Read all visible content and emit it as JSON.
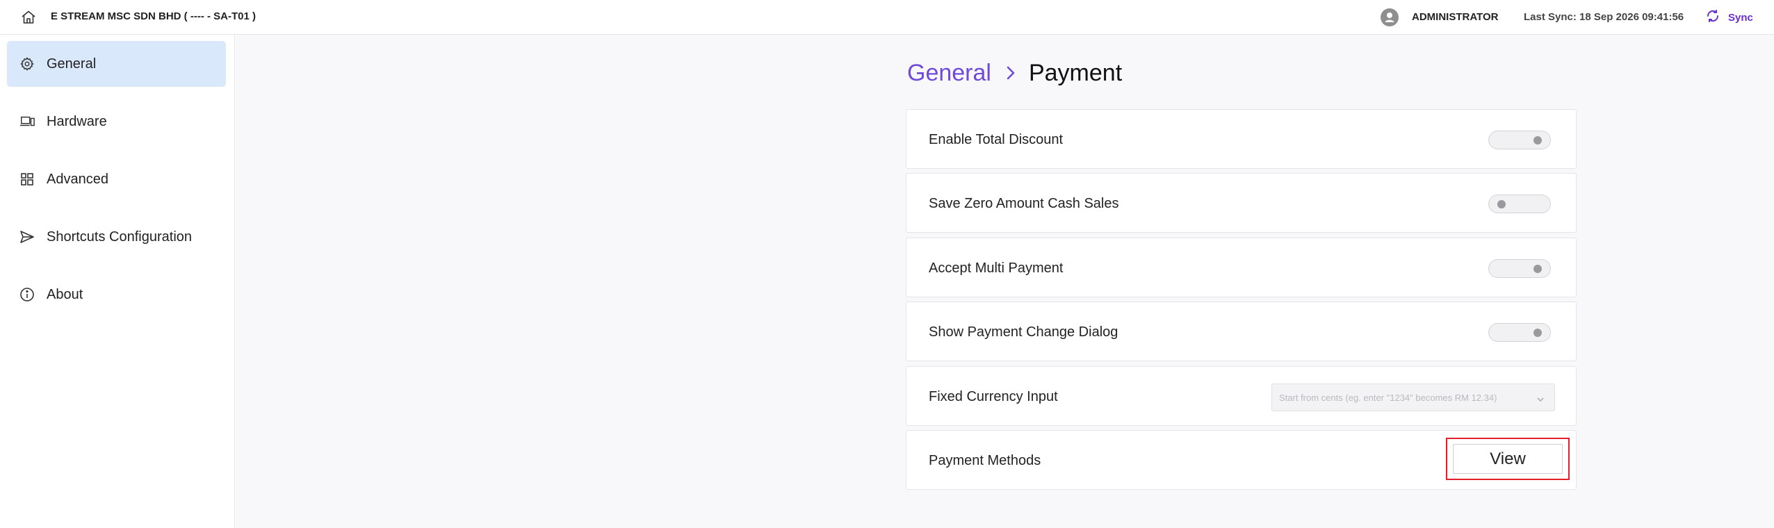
{
  "header": {
    "company": "E STREAM MSC SDN BHD ( ---- - SA-T01 )",
    "user": "ADMINISTRATOR",
    "last_sync": "Last Sync: 18 Sep 2026 09:41:56",
    "sync_label": "Sync",
    "accent_color": "#6a2fd4"
  },
  "sidebar": {
    "items": [
      {
        "label": "General",
        "icon": "gear-icon",
        "active": true
      },
      {
        "label": "Hardware",
        "icon": "devices-icon",
        "active": false
      },
      {
        "label": "Advanced",
        "icon": "dashboard-icon",
        "active": false
      },
      {
        "label": "Shortcuts Configuration",
        "icon": "send-icon",
        "active": false
      },
      {
        "label": "About",
        "icon": "info-icon",
        "active": false
      }
    ]
  },
  "breadcrumb": {
    "parent": "General",
    "current": "Payment"
  },
  "settings": [
    {
      "label": "Enable Total Discount",
      "control": "toggle",
      "value": "on"
    },
    {
      "label": "Save Zero Amount Cash Sales",
      "control": "toggle",
      "value": "off"
    },
    {
      "label": "Accept Multi Payment",
      "control": "toggle",
      "value": "on"
    },
    {
      "label": "Show Payment Change Dialog",
      "control": "toggle",
      "value": "on"
    },
    {
      "label": "Fixed Currency Input",
      "control": "select",
      "placeholder": "Start from cents (eg. enter \"1234\" becomes RM 12.34)"
    },
    {
      "label": "Payment Methods",
      "control": "button",
      "button_label": "View"
    }
  ]
}
